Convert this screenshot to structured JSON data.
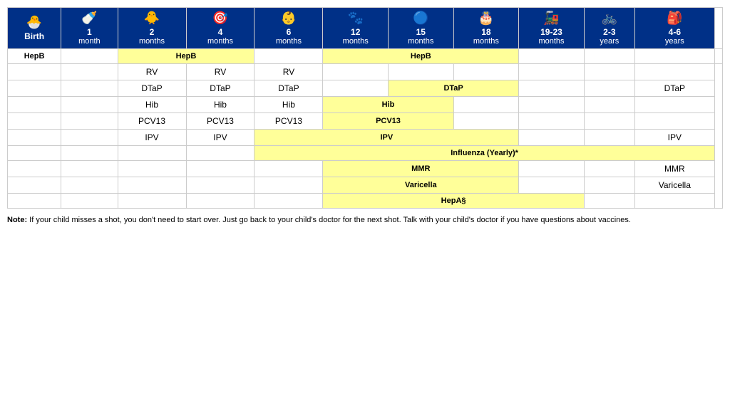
{
  "headers": [
    {
      "id": "birth",
      "icon": "🐣",
      "line1": "Birth",
      "line2": ""
    },
    {
      "id": "1mo",
      "icon": "🍼",
      "line1": "1",
      "line2": "month"
    },
    {
      "id": "2mo",
      "icon": "🐥",
      "line1": "2",
      "line2": "months"
    },
    {
      "id": "4mo",
      "icon": "🎯",
      "line1": "4",
      "line2": "months"
    },
    {
      "id": "6mo",
      "icon": "👶",
      "line1": "6",
      "line2": "months"
    },
    {
      "id": "12mo",
      "icon": "🐾",
      "line1": "12",
      "line2": "months"
    },
    {
      "id": "15mo",
      "icon": "🔵",
      "line1": "15",
      "line2": "months"
    },
    {
      "id": "18mo",
      "icon": "🎂",
      "line1": "18",
      "line2": "months"
    },
    {
      "id": "19-23mo",
      "icon": "🚂",
      "line1": "19-23",
      "line2": "months"
    },
    {
      "id": "2-3yr",
      "icon": "🚲",
      "line1": "2-3",
      "line2": "years"
    },
    {
      "id": "4-6yr",
      "icon": "🎒",
      "line1": "4-6",
      "line2": "years"
    }
  ],
  "rows": [
    {
      "label": "HepB",
      "cells": [
        {
          "col": "birth",
          "text": "",
          "yellow": false
        },
        {
          "col": "1mo",
          "text": "HepB",
          "yellow": true,
          "colspan": 2
        },
        {
          "col": "2mo",
          "skip": true
        },
        {
          "col": "4mo",
          "text": "",
          "yellow": false
        },
        {
          "col": "6mo",
          "text": "HepB",
          "yellow": true,
          "colspan": 3
        },
        {
          "col": "12mo",
          "skip": true
        },
        {
          "col": "15mo",
          "skip": true
        },
        {
          "col": "18mo",
          "text": "",
          "yellow": false
        },
        {
          "col": "19-23mo",
          "text": "",
          "yellow": false
        },
        {
          "col": "2-3yr",
          "text": "",
          "yellow": false
        },
        {
          "col": "4-6yr",
          "text": "",
          "yellow": false
        }
      ]
    },
    {
      "label": "",
      "cells": [
        {
          "col": "birth",
          "text": "",
          "yellow": false
        },
        {
          "col": "1mo",
          "text": "",
          "yellow": false
        },
        {
          "col": "2mo",
          "text": "RV",
          "yellow": false
        },
        {
          "col": "4mo",
          "text": "RV",
          "yellow": false
        },
        {
          "col": "6mo",
          "text": "RV",
          "yellow": false
        },
        {
          "col": "12mo",
          "text": "",
          "yellow": false
        },
        {
          "col": "15mo",
          "text": "",
          "yellow": false
        },
        {
          "col": "18mo",
          "text": "",
          "yellow": false
        },
        {
          "col": "19-23mo",
          "text": "",
          "yellow": false
        },
        {
          "col": "2-3yr",
          "text": "",
          "yellow": false
        },
        {
          "col": "4-6yr",
          "text": "",
          "yellow": false
        }
      ]
    },
    {
      "label": "",
      "cells": [
        {
          "col": "birth",
          "text": "",
          "yellow": false
        },
        {
          "col": "1mo",
          "text": "",
          "yellow": false
        },
        {
          "col": "2mo",
          "text": "DTaP",
          "yellow": false
        },
        {
          "col": "4mo",
          "text": "DTaP",
          "yellow": false
        },
        {
          "col": "6mo",
          "text": "DTaP",
          "yellow": false
        },
        {
          "col": "12mo",
          "text": "",
          "yellow": false
        },
        {
          "col": "15mo",
          "text": "DTaP",
          "yellow": true,
          "colspan": 2
        },
        {
          "col": "18mo",
          "skip": true
        },
        {
          "col": "19-23mo",
          "text": "",
          "yellow": false
        },
        {
          "col": "2-3yr",
          "text": "",
          "yellow": false
        },
        {
          "col": "4-6yr",
          "text": "DTaP",
          "yellow": false
        }
      ]
    },
    {
      "label": "",
      "cells": [
        {
          "col": "birth",
          "text": "",
          "yellow": false
        },
        {
          "col": "1mo",
          "text": "",
          "yellow": false
        },
        {
          "col": "2mo",
          "text": "Hib",
          "yellow": false
        },
        {
          "col": "4mo",
          "text": "Hib",
          "yellow": false
        },
        {
          "col": "6mo",
          "text": "Hib",
          "yellow": false
        },
        {
          "col": "12mo",
          "text": "Hib",
          "yellow": true,
          "colspan": 2
        },
        {
          "col": "15mo",
          "skip": true
        },
        {
          "col": "18mo",
          "text": "",
          "yellow": false
        },
        {
          "col": "19-23mo",
          "text": "",
          "yellow": false
        },
        {
          "col": "2-3yr",
          "text": "",
          "yellow": false
        },
        {
          "col": "4-6yr",
          "text": "",
          "yellow": false
        }
      ]
    },
    {
      "label": "",
      "cells": [
        {
          "col": "birth",
          "text": "",
          "yellow": false
        },
        {
          "col": "1mo",
          "text": "",
          "yellow": false
        },
        {
          "col": "2mo",
          "text": "PCV13",
          "yellow": false
        },
        {
          "col": "4mo",
          "text": "PCV13",
          "yellow": false
        },
        {
          "col": "6mo",
          "text": "PCV13",
          "yellow": false
        },
        {
          "col": "12mo",
          "text": "PCV13",
          "yellow": true,
          "colspan": 2
        },
        {
          "col": "15mo",
          "skip": true
        },
        {
          "col": "18mo",
          "text": "",
          "yellow": false
        },
        {
          "col": "19-23mo",
          "text": "",
          "yellow": false
        },
        {
          "col": "2-3yr",
          "text": "",
          "yellow": false
        },
        {
          "col": "4-6yr",
          "text": "",
          "yellow": false
        }
      ]
    },
    {
      "label": "",
      "cells": [
        {
          "col": "birth",
          "text": "",
          "yellow": false
        },
        {
          "col": "1mo",
          "text": "",
          "yellow": false
        },
        {
          "col": "2mo",
          "text": "IPV",
          "yellow": false
        },
        {
          "col": "4mo",
          "text": "IPV",
          "yellow": false
        },
        {
          "col": "6mo",
          "text": "IPV",
          "yellow": true,
          "colspan": 4
        },
        {
          "col": "12mo",
          "skip": true
        },
        {
          "col": "15mo",
          "skip": true
        },
        {
          "col": "18mo",
          "skip": true
        },
        {
          "col": "19-23mo",
          "text": "",
          "yellow": false
        },
        {
          "col": "2-3yr",
          "text": "",
          "yellow": false
        },
        {
          "col": "4-6yr",
          "text": "IPV",
          "yellow": false
        }
      ]
    },
    {
      "label": "",
      "cells": [
        {
          "col": "birth",
          "text": "",
          "yellow": false
        },
        {
          "col": "1mo",
          "text": "",
          "yellow": false
        },
        {
          "col": "2mo",
          "text": "",
          "yellow": false
        },
        {
          "col": "4mo",
          "text": "",
          "yellow": false
        },
        {
          "col": "6mo",
          "text": "Influenza (Yearly)*",
          "yellow": true,
          "colspan": 7
        },
        {
          "col": "12mo",
          "skip": true
        },
        {
          "col": "15mo",
          "skip": true
        },
        {
          "col": "18mo",
          "skip": true
        },
        {
          "col": "19-23mo",
          "skip": true
        },
        {
          "col": "2-3yr",
          "skip": true
        },
        {
          "col": "4-6yr",
          "skip": true
        }
      ]
    },
    {
      "label": "",
      "cells": [
        {
          "col": "birth",
          "text": "",
          "yellow": false
        },
        {
          "col": "1mo",
          "text": "",
          "yellow": false
        },
        {
          "col": "2mo",
          "text": "",
          "yellow": false
        },
        {
          "col": "4mo",
          "text": "",
          "yellow": false
        },
        {
          "col": "6mo",
          "text": "",
          "yellow": false
        },
        {
          "col": "12mo",
          "text": "MMR",
          "yellow": true,
          "colspan": 3
        },
        {
          "col": "15mo",
          "skip": true
        },
        {
          "col": "18mo",
          "skip": true
        },
        {
          "col": "19-23mo",
          "text": "",
          "yellow": false
        },
        {
          "col": "2-3yr",
          "text": "",
          "yellow": false
        },
        {
          "col": "4-6yr",
          "text": "MMR",
          "yellow": false
        }
      ]
    },
    {
      "label": "",
      "cells": [
        {
          "col": "birth",
          "text": "",
          "yellow": false
        },
        {
          "col": "1mo",
          "text": "",
          "yellow": false
        },
        {
          "col": "2mo",
          "text": "",
          "yellow": false
        },
        {
          "col": "4mo",
          "text": "",
          "yellow": false
        },
        {
          "col": "6mo",
          "text": "",
          "yellow": false
        },
        {
          "col": "12mo",
          "text": "Varicella",
          "yellow": true,
          "colspan": 3
        },
        {
          "col": "15mo",
          "skip": true
        },
        {
          "col": "18mo",
          "skip": true
        },
        {
          "col": "19-23mo",
          "text": "",
          "yellow": false
        },
        {
          "col": "2-3yr",
          "text": "",
          "yellow": false
        },
        {
          "col": "4-6yr",
          "text": "Varicella",
          "yellow": false
        }
      ]
    },
    {
      "label": "",
      "cells": [
        {
          "col": "birth",
          "text": "",
          "yellow": false
        },
        {
          "col": "1mo",
          "text": "",
          "yellow": false
        },
        {
          "col": "2mo",
          "text": "",
          "yellow": false
        },
        {
          "col": "4mo",
          "text": "",
          "yellow": false
        },
        {
          "col": "6mo",
          "text": "",
          "yellow": false
        },
        {
          "col": "12mo",
          "text": "HepA§",
          "yellow": true,
          "colspan": 4
        },
        {
          "col": "15mo",
          "skip": true
        },
        {
          "col": "18mo",
          "skip": true
        },
        {
          "col": "19-23mo",
          "skip": true
        },
        {
          "col": "2-3yr",
          "text": "",
          "yellow": false
        },
        {
          "col": "4-6yr",
          "text": "",
          "yellow": false
        }
      ]
    }
  ],
  "note": "Note: If your child misses a shot, you don't need to start over. Just go back to your child's doctor for the next shot. Talk with your child's doctor if you have questions about vaccines."
}
